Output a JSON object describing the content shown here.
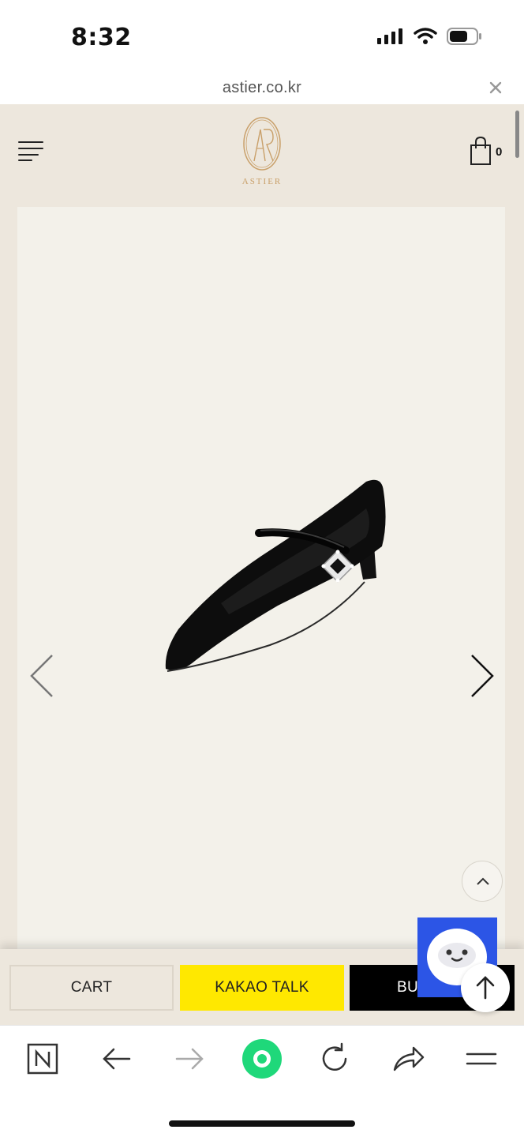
{
  "status_bar": {
    "time": "8:32",
    "icons": [
      "signal-icon",
      "wifi-icon",
      "battery-icon"
    ]
  },
  "address_bar": {
    "url": "astier.co.kr",
    "close_icon": "close-icon"
  },
  "site_header": {
    "logo_text": "ASTIER",
    "cart_count": "0",
    "menu_icon": "hamburger-menu-icon",
    "cart_icon": "shopping-bag-icon"
  },
  "product": {
    "image": "black-mary-jane-flat-shoe-with-crystal-buckle",
    "prev_icon": "chevron-left-icon",
    "next_icon": "chevron-right-icon"
  },
  "buy_bar": {
    "cart_label": "CART",
    "kakao_label": "KAKAO TALK",
    "buy_label": "BU"
  },
  "toolbar": {
    "icons": [
      "naver-n-icon",
      "back-arrow-icon",
      "forward-arrow-icon",
      "green-circle-icon",
      "reload-icon",
      "share-icon",
      "menu-icon"
    ]
  },
  "colors": {
    "site_bg": "#ede7dd",
    "panel_bg": "#f3f1ea",
    "kakao_yellow": "#ffe800",
    "chatbot_blue": "#2c55e6",
    "logo_gold": "#c9a06a",
    "green_accent": "#1fd87a"
  }
}
